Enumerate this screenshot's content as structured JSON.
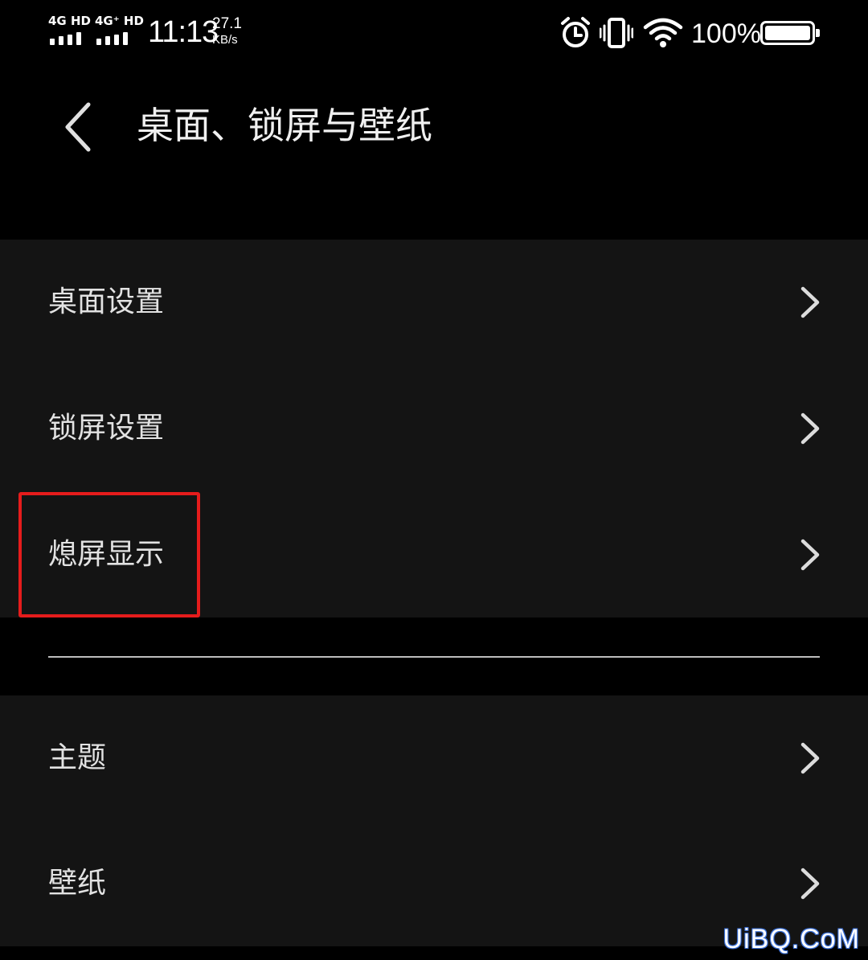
{
  "status_bar": {
    "sim1_network": "4G HD",
    "sim2_network": "4G⁺ HD",
    "time": "11:13",
    "net_speed_value": "27.1",
    "net_speed_unit": "KB/s",
    "icons": [
      "alarm-icon",
      "vibrate-icon",
      "wifi-icon"
    ],
    "battery_percent": "100%"
  },
  "header": {
    "back_icon": "chevron-left-icon",
    "title": "桌面、锁屏与壁纸"
  },
  "groups": [
    {
      "items": [
        {
          "label": "桌面设置",
          "icon": "chevron-right-icon"
        },
        {
          "label": "锁屏设置",
          "icon": "chevron-right-icon"
        },
        {
          "label": "熄屏显示",
          "icon": "chevron-right-icon",
          "highlighted": true
        }
      ]
    },
    {
      "items": [
        {
          "label": "主题",
          "icon": "chevron-right-icon"
        },
        {
          "label": "壁纸",
          "icon": "chevron-right-icon"
        }
      ]
    }
  ],
  "annotation": {
    "color": "#e51c1c"
  },
  "watermark": "UiBQ.CoM",
  "colors": {
    "background": "#000000",
    "group_background": "#141414",
    "text": "#e2e2e2",
    "divider": "#bdbdbd"
  }
}
